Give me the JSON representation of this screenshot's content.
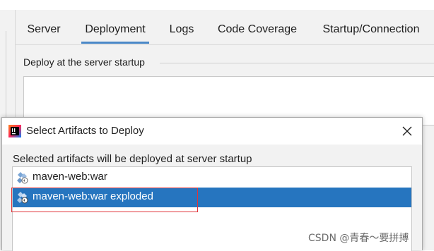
{
  "tabs": [
    {
      "label": "Server",
      "active": false
    },
    {
      "label": "Deployment",
      "active": true
    },
    {
      "label": "Logs",
      "active": false
    },
    {
      "label": "Code Coverage",
      "active": false
    },
    {
      "label": "Startup/Connection",
      "active": false
    }
  ],
  "deploy_group": {
    "title": "Deploy at the server startup"
  },
  "dialog": {
    "title": "Select Artifacts to Deploy",
    "label": "Selected artifacts will be deployed at server startup",
    "artifacts": [
      {
        "label": "maven-web:war",
        "selected": false,
        "icon": "artifact-icon"
      },
      {
        "label": "maven-web:war exploded",
        "selected": true,
        "icon": "artifact-icon"
      }
    ]
  },
  "colors": {
    "accent": "#2675bf",
    "tab_underline": "#4a88c7",
    "highlight_box": "#e0343a"
  },
  "watermark": "CSDN @青春～要拼搏"
}
